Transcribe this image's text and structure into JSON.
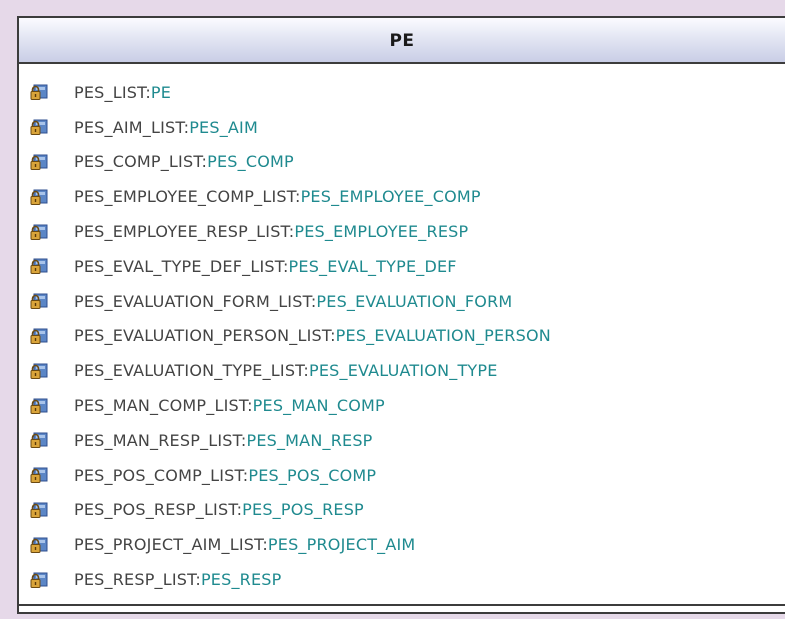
{
  "class_box": {
    "title": "PE",
    "attributes": [
      {
        "name": "PES_LIST",
        "type": "PE"
      },
      {
        "name": "PES_AIM_LIST",
        "type": "PES_AIM"
      },
      {
        "name": "PES_COMP_LIST",
        "type": "PES_COMP"
      },
      {
        "name": "PES_EMPLOYEE_COMP_LIST",
        "type": "PES_EMPLOYEE_COMP"
      },
      {
        "name": "PES_EMPLOYEE_RESP_LIST",
        "type": "PES_EMPLOYEE_RESP"
      },
      {
        "name": "PES_EVAL_TYPE_DEF_LIST",
        "type": "PES_EVAL_TYPE_DEF"
      },
      {
        "name": "PES_EVALUATION_FORM_LIST",
        "type": "PES_EVALUATION_FORM"
      },
      {
        "name": "PES_EVALUATION_PERSON_LIST",
        "type": "PES_EVALUATION_PERSON"
      },
      {
        "name": "PES_EVALUATION_TYPE_LIST",
        "type": "PES_EVALUATION_TYPE"
      },
      {
        "name": "PES_MAN_COMP_LIST",
        "type": "PES_MAN_COMP"
      },
      {
        "name": "PES_MAN_RESP_LIST",
        "type": "PES_MAN_RESP"
      },
      {
        "name": "PES_POS_COMP_LIST",
        "type": "PES_POS_COMP"
      },
      {
        "name": "PES_POS_RESP_LIST",
        "type": "PES_POS_RESP"
      },
      {
        "name": "PES_PROJECT_AIM_LIST",
        "type": "PES_PROJECT_AIM"
      },
      {
        "name": "PES_RESP_LIST",
        "type": "PES_RESP"
      }
    ],
    "separator": ":",
    "attribute_icon": "protected-attribute-icon"
  },
  "colors": {
    "background": "#e6d9e9",
    "header_gradient_bottom": "#c9cee6",
    "attribute_name": "#444444",
    "attribute_type": "#1f8a8f",
    "border": "#3c3c3c"
  }
}
